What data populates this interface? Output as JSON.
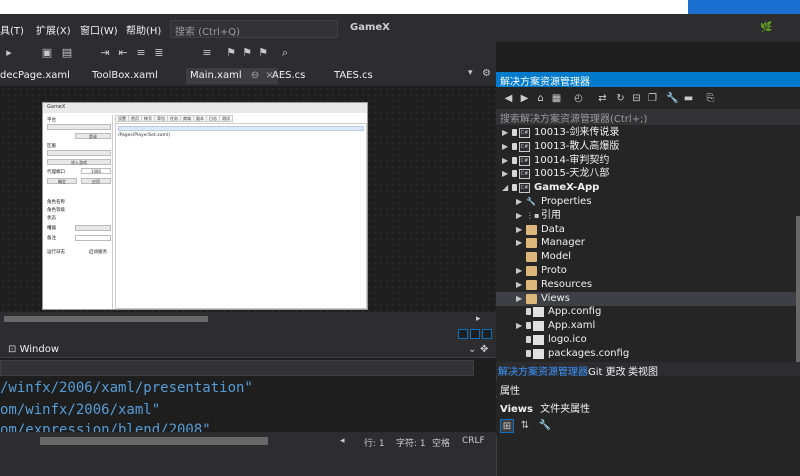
{
  "menu": {
    "items": [
      "具(T)",
      "扩展(X)",
      "窗口(W)",
      "帮助(H)"
    ]
  },
  "search": {
    "placeholder": "搜索 (Ctrl+Q)"
  },
  "app_title": "GameX",
  "live_share": "🌿",
  "tabs": [
    {
      "label": "decPage.xaml"
    },
    {
      "label": "ToolBox.xaml"
    },
    {
      "label": "Main.xaml",
      "active": true,
      "pin": "⊖",
      "close": "×"
    },
    {
      "label": "AES.cs"
    },
    {
      "label": "TAES.cs"
    }
  ],
  "preview": {
    "title": "GameX",
    "left_labels": [
      "平台",
      "区服",
      "代理端口",
      "角色名称",
      "角色等级",
      "状态",
      "槽器",
      "备注",
      "运行日志"
    ],
    "buttons": [
      "登录",
      "进入游戏",
      "确定",
      "应用"
    ],
    "port_value": "1080",
    "checkbox_label": "启动服务",
    "tabs": [
      "设置",
      "首页",
      "帐号",
      "背包",
      "任务",
      "商城",
      "副本",
      "日志",
      "测试"
    ],
    "path": "/Pages/PlayerSet.xaml)"
  },
  "xaml": {
    "breadcrumb": "Window",
    "code_lines": [
      "/winfx/2006/xaml/presentation\"",
      "om/winfx/2006/xaml\"",
      "om/expression/blend/2008\""
    ]
  },
  "status": {
    "line": "行: 1",
    "char": "字符: 1",
    "spaces": "空格",
    "eol": "CRLF"
  },
  "solution_explorer": {
    "title": "解决方案资源管理器",
    "search_placeholder": "搜索解决方案资源管理器(Ctrl+;)",
    "tree": [
      {
        "label": "10013-剑来传说录",
        "type": "project",
        "indent": 0,
        "arrow": "▶"
      },
      {
        "label": "10013-散人高爆版",
        "type": "project",
        "indent": 0,
        "arrow": "▶"
      },
      {
        "label": "10014-审判契约",
        "type": "project",
        "indent": 0,
        "arrow": "▶"
      },
      {
        "label": "10015-天龙八部",
        "type": "project",
        "indent": 0,
        "arrow": "▶"
      },
      {
        "label": "GameX-App",
        "type": "project",
        "indent": 0,
        "arrow": "◢",
        "bold": true
      },
      {
        "label": "Properties",
        "type": "wrench",
        "indent": 1,
        "arrow": "▶"
      },
      {
        "label": "引用",
        "type": "refs",
        "indent": 1,
        "arrow": "▶"
      },
      {
        "label": "Data",
        "type": "folder",
        "indent": 1,
        "arrow": "▶"
      },
      {
        "label": "Manager",
        "type": "folder",
        "indent": 1,
        "arrow": "▶"
      },
      {
        "label": "Model",
        "type": "folder",
        "indent": 1,
        "arrow": ""
      },
      {
        "label": "Proto",
        "type": "folder",
        "indent": 1,
        "arrow": "▶"
      },
      {
        "label": "Resources",
        "type": "folder",
        "indent": 1,
        "arrow": "▶"
      },
      {
        "label": "Views",
        "type": "folder",
        "indent": 1,
        "arrow": "▶",
        "selected": true
      },
      {
        "label": "App.config",
        "type": "file",
        "indent": 1,
        "arrow": ""
      },
      {
        "label": "App.xaml",
        "type": "file",
        "indent": 1,
        "arrow": "▶"
      },
      {
        "label": "logo.ico",
        "type": "file",
        "indent": 1,
        "arrow": ""
      },
      {
        "label": "packages.config",
        "type": "file",
        "indent": 1,
        "arrow": ""
      }
    ],
    "bottom_tabs": [
      "解决方案资源管理器",
      "Git 更改",
      "类视图"
    ]
  },
  "properties": {
    "header": "属性",
    "object_name": "Views",
    "object_type": "文件夹属性"
  },
  "colors": {
    "accent": "#007acc",
    "folder": "#dcb67a",
    "code": "#569cd6"
  }
}
